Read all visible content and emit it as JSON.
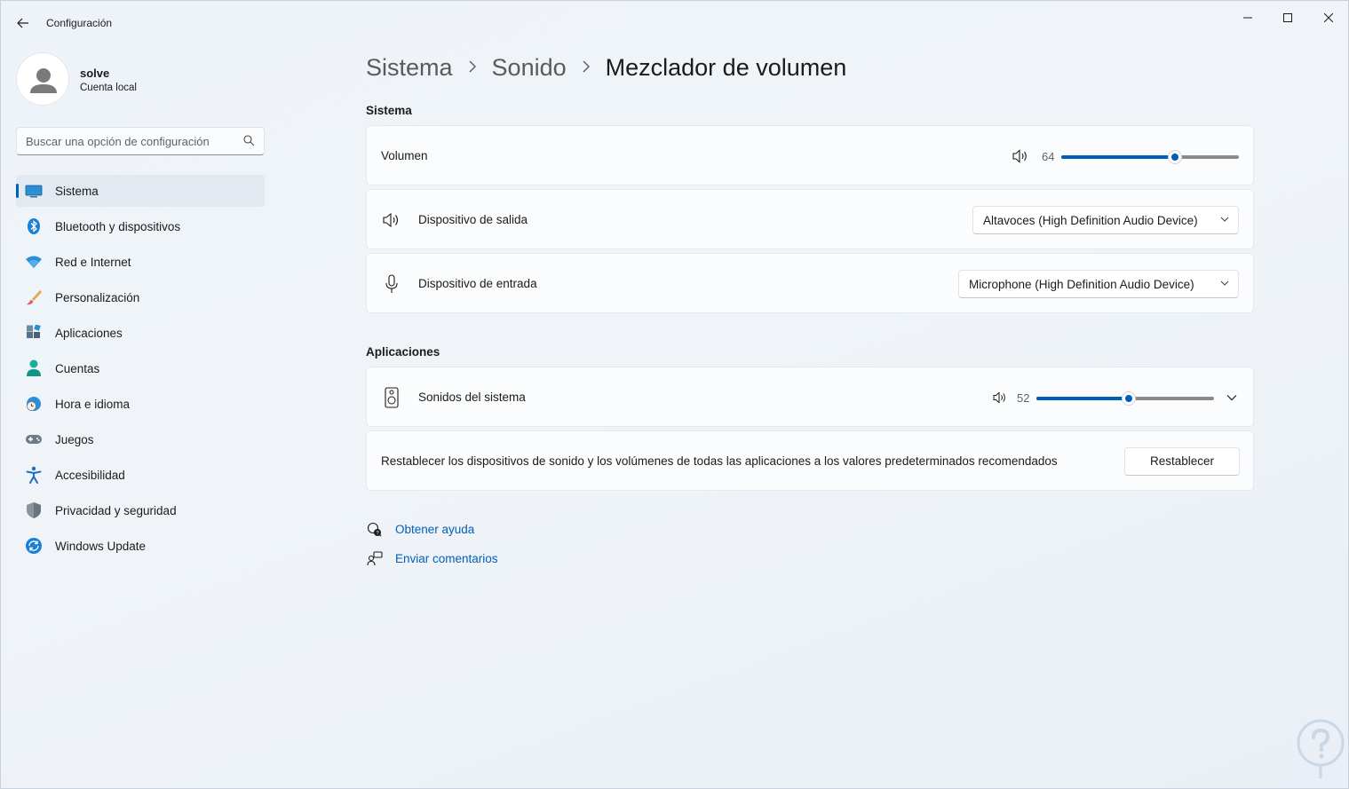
{
  "window": {
    "title": "Configuración",
    "controls": [
      "minimize",
      "maximize",
      "close"
    ]
  },
  "profile": {
    "name": "solve",
    "account_type": "Cuenta local"
  },
  "search": {
    "placeholder": "Buscar una opción de configuración"
  },
  "sidebar": {
    "items": [
      {
        "label": "Sistema",
        "icon": "monitor-icon",
        "selected": true
      },
      {
        "label": "Bluetooth y dispositivos",
        "icon": "bluetooth-icon"
      },
      {
        "label": "Red e Internet",
        "icon": "wifi-icon"
      },
      {
        "label": "Personalización",
        "icon": "brush-icon"
      },
      {
        "label": "Aplicaciones",
        "icon": "apps-icon"
      },
      {
        "label": "Cuentas",
        "icon": "person-icon"
      },
      {
        "label": "Hora e idioma",
        "icon": "globe-clock-icon"
      },
      {
        "label": "Juegos",
        "icon": "gamepad-icon"
      },
      {
        "label": "Accesibilidad",
        "icon": "accessibility-icon"
      },
      {
        "label": "Privacidad y seguridad",
        "icon": "shield-icon"
      },
      {
        "label": "Windows Update",
        "icon": "update-icon"
      }
    ]
  },
  "breadcrumb": {
    "items": [
      "Sistema",
      "Sonido"
    ],
    "current": "Mezclador de volumen"
  },
  "sistema": {
    "section_title": "Sistema",
    "volume": {
      "label": "Volumen",
      "value": 64
    },
    "output": {
      "label": "Dispositivo de salida",
      "selected": "Altavoces (High Definition Audio Device)"
    },
    "input": {
      "label": "Dispositivo de entrada",
      "selected": "Microphone (High Definition Audio Device)"
    }
  },
  "apps": {
    "section_title": "Aplicaciones",
    "system_sounds": {
      "label": "Sonidos del sistema",
      "value": 52
    },
    "reset": {
      "description": "Restablecer los dispositivos de sonido y los volúmenes de todas las aplicaciones a los valores predeterminados recomendados",
      "button_label": "Restablecer"
    }
  },
  "links": {
    "help": "Obtener ayuda",
    "feedback": "Enviar comentarios"
  },
  "colors": {
    "accent": "#005fb8",
    "background": "#eef3f9",
    "card": "#fbfcfd"
  }
}
